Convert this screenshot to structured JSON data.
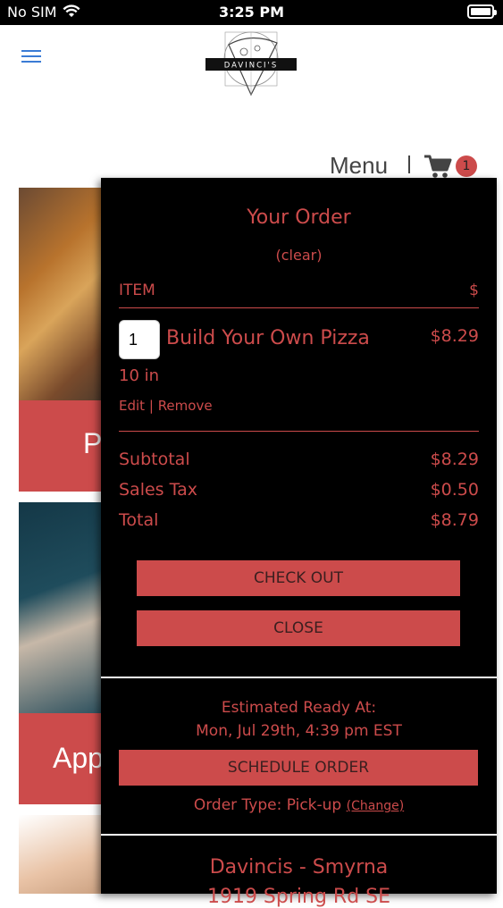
{
  "status_bar": {
    "carrier": "No SIM",
    "time": "3:25 PM"
  },
  "header": {
    "logo_text": "DAVINCI'S",
    "nav_menu": "Menu",
    "cart_count": "1"
  },
  "cards": [
    {
      "label": "P"
    },
    {
      "label": "App"
    }
  ],
  "order": {
    "title": "Your Order",
    "clear": "(clear)",
    "col_item": "ITEM",
    "col_price": "$",
    "items": [
      {
        "qty": "1",
        "name": "Build Your Own Pizza",
        "price": "$8.29",
        "size": "10 in",
        "edit": "Edit",
        "sep": "|",
        "remove": "Remove"
      }
    ],
    "subtotal_label": "Subtotal",
    "subtotal": "$8.29",
    "tax_label": "Sales Tax",
    "tax": "$0.50",
    "total_label": "Total",
    "total": "$8.79",
    "checkout": "CHECK OUT",
    "close": "CLOSE",
    "estimated_label": "Estimated Ready At:",
    "estimated_time": "Mon, Jul 29th, 4:39 pm EST",
    "schedule": "SCHEDULE ORDER",
    "order_type_label": "Order Type: Pick-up",
    "change": "(Change)",
    "store_name": "Davincis - Smyrna",
    "store_address": "1919 Spring Rd SE"
  },
  "colors": {
    "accent": "#cc4b4b",
    "panel_bg": "#000000",
    "hamburger": "#3a7bd5"
  }
}
